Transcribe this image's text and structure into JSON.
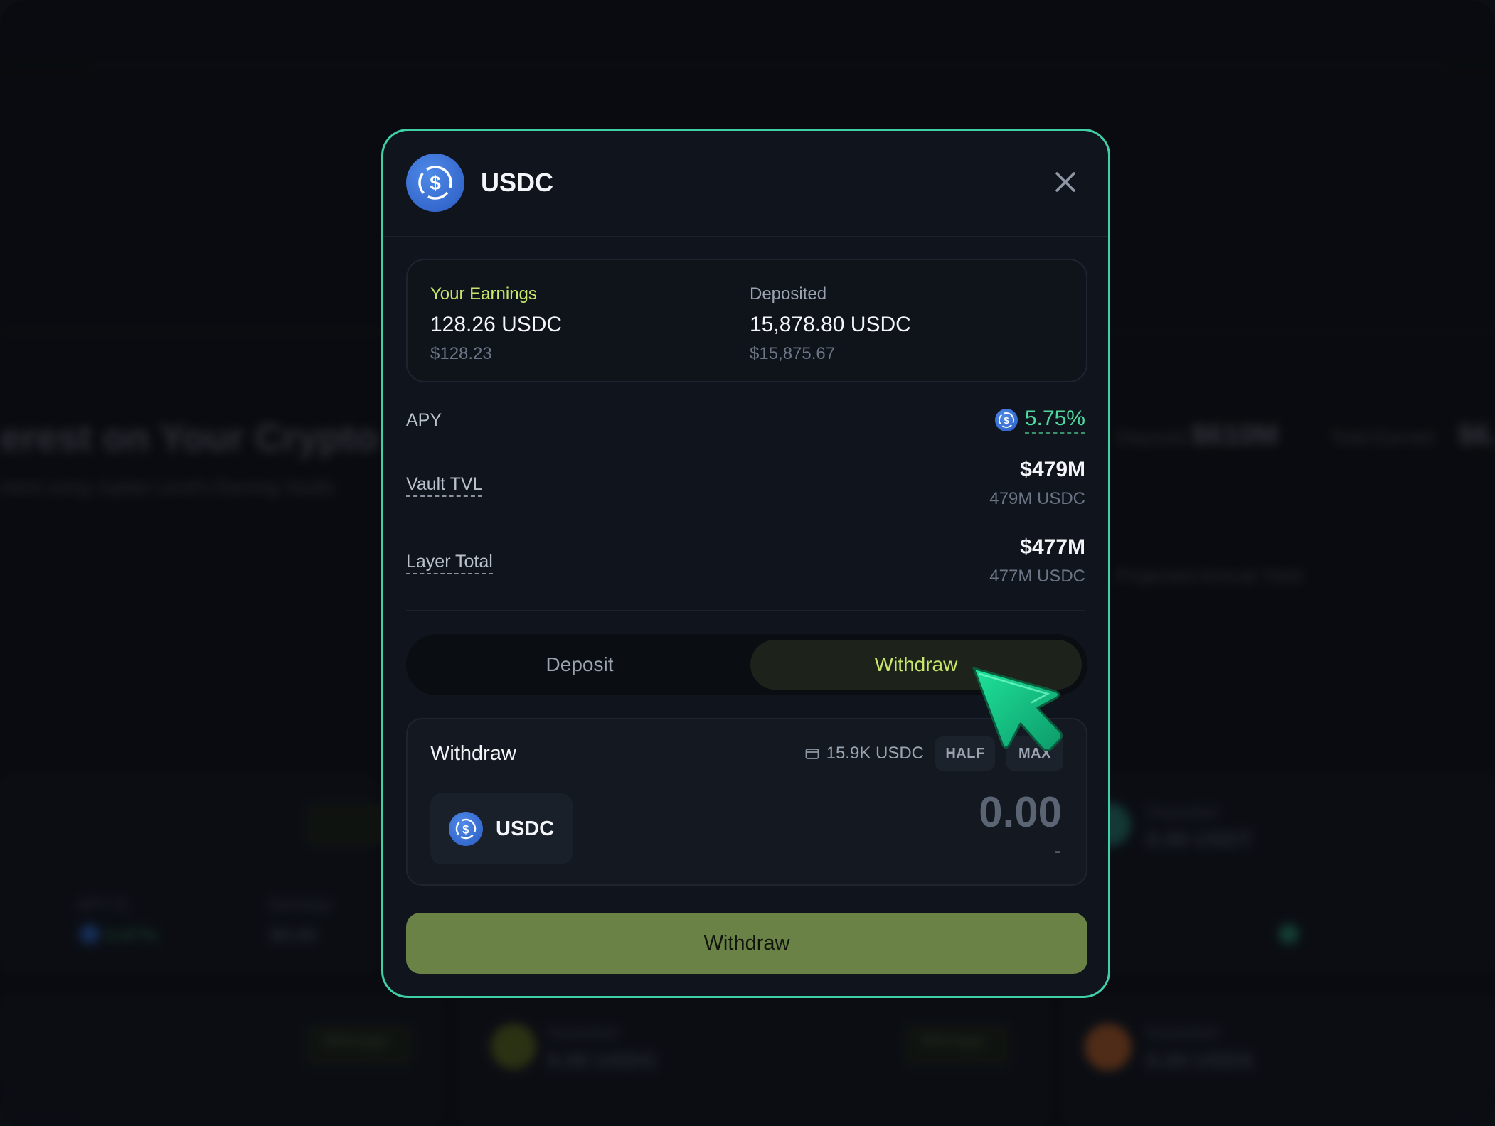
{
  "background": {
    "heading": "erest on Your Crypto",
    "subheading": "ment using Jupiter Lend's Earning Vaults",
    "deposits_label": "Deposits",
    "deposits_value": "$610M",
    "total_earned_label": "Total Earned",
    "total_earned_value": "$6.",
    "manage_label": "Manage",
    "deposited_label": "Deposited",
    "deposited_values": [
      "0.00 USDT",
      "0.00 USDG",
      "0.00 USDS"
    ],
    "apy_label": "APY %",
    "apy_value": "5.67%",
    "earnings_label": "Earnings",
    "earnings_value": "$0.00",
    "projected_label": "Projected Annual Yield"
  },
  "modal": {
    "token": "USDC",
    "close_icon": "close-icon",
    "earnings": {
      "label": "Your Earnings",
      "amount": "128.26 USDC",
      "usd": "$128.23"
    },
    "deposited": {
      "label": "Deposited",
      "amount": "15,878.80 USDC",
      "usd": "$15,875.67"
    },
    "apy": {
      "label": "APY",
      "value": "5.75%"
    },
    "vault_tvl": {
      "label": "Vault TVL",
      "usd": "$479M",
      "amount": "479M USDC"
    },
    "layer_total": {
      "label": "Layer Total",
      "usd": "$477M",
      "amount": "477M USDC"
    },
    "tabs": [
      {
        "label": "Deposit",
        "active": false
      },
      {
        "label": "Withdraw",
        "active": true
      }
    ],
    "withdraw_panel": {
      "title": "Withdraw",
      "balance": "15.9K USDC",
      "half_label": "HALF",
      "max_label": "MAX",
      "token": "USDC",
      "amount_placeholder": "0.00",
      "usd_value": "-"
    },
    "submit_label": "Withdraw"
  },
  "colors": {
    "accent_border": "#3fd0a8",
    "earnings_label": "#c8e66b",
    "apy_value": "#4fd8a0",
    "usdc_blue": "#2f6fd6",
    "submit_bg": "#6b8247",
    "cursor": "#18c98a"
  }
}
